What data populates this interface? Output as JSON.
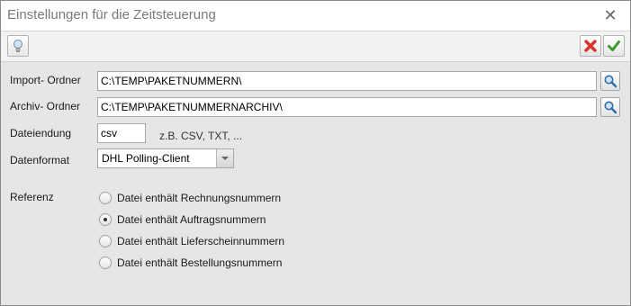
{
  "window": {
    "title": "Einstellungen für die Zeitsteuerung",
    "close_glyph": "✕"
  },
  "toolbar": {
    "hint_icon": "lightbulb-icon",
    "cancel_icon": "red-x-icon",
    "ok_icon": "green-check-icon"
  },
  "form": {
    "import_label": "Import- Ordner",
    "import_value": "C:\\TEMP\\PAKETNUMMERN\\",
    "archive_label": "Archiv- Ordner",
    "archive_value": "C:\\TEMP\\PAKETNUMMERNARCHIV\\",
    "ext_label": "Dateiendung",
    "ext_value": "csv",
    "ext_hint": "z.B. CSV, TXT, ...",
    "format_label": "Datenformat",
    "format_value": "DHL Polling-Client",
    "reference_label": "Referenz",
    "reference_options": [
      {
        "label": "Datei enthält Rechnungsnummern",
        "checked": false
      },
      {
        "label": "Datei enthält Auftragsnummern",
        "checked": true
      },
      {
        "label": "Datei enthält Lieferscheinnummern",
        "checked": false
      },
      {
        "label": "Datei enthält Bestellungsnummern",
        "checked": false
      }
    ]
  },
  "colors": {
    "cancel": "#d9342b",
    "ok": "#3a9a2a",
    "bulb": "#9fc5e8"
  }
}
